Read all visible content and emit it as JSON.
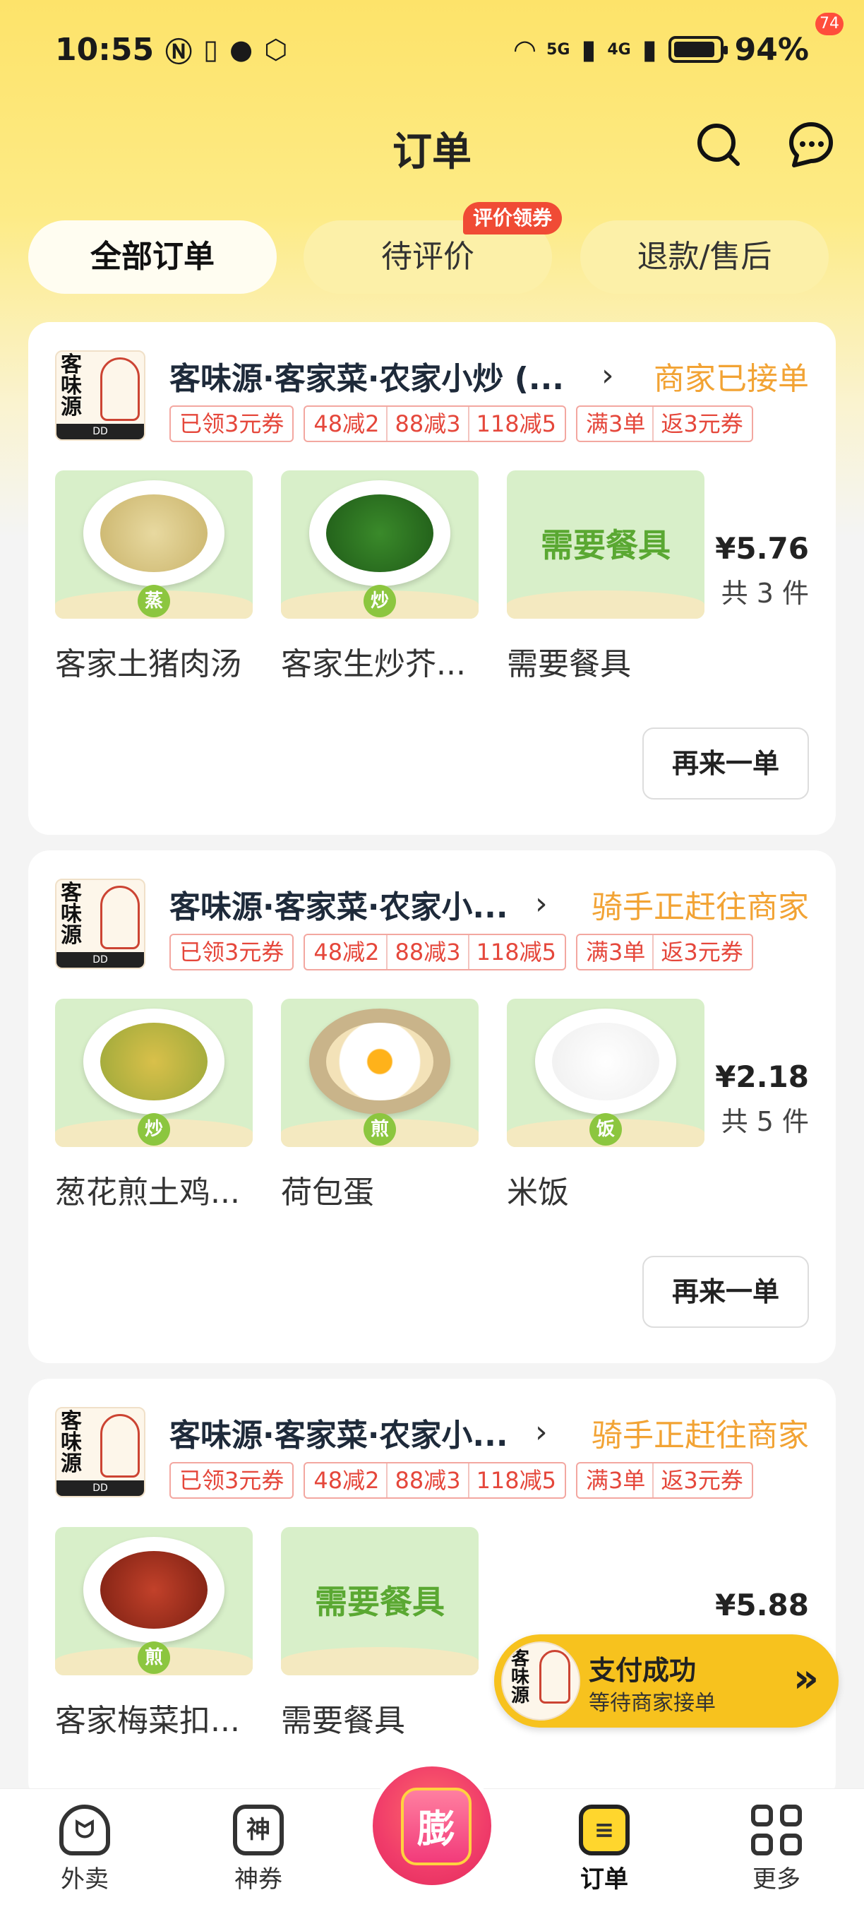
{
  "status_bar": {
    "time": "10:55",
    "battery": "94%",
    "net1": "5G",
    "net2": "4G"
  },
  "header": {
    "title": "订单",
    "message_count": "74"
  },
  "tabs": [
    {
      "label": "全部订单"
    },
    {
      "label": "待评价"
    },
    {
      "label": "退款/售后"
    }
  ],
  "tab_badge": "评价领券",
  "orders": [
    {
      "shop_name": "客味源·客家菜·农家小炒 (...",
      "status": "商家已接单",
      "promos": {
        "coupon": "已领3元券",
        "discounts": [
          "48减2",
          "88减3",
          "118减5"
        ],
        "bundle": [
          "满3单",
          "返3元券"
        ]
      },
      "items": [
        {
          "name": "客家土猪肉汤",
          "tag": "蒸"
        },
        {
          "name": "客家生炒芥...",
          "tag": "炒"
        },
        {
          "name": "需要餐具",
          "thumb_text": "需要餐具"
        }
      ],
      "price": "¥5.76",
      "count": "共 3 件",
      "reorder": "再来一单"
    },
    {
      "shop_name": "客味源·客家菜·农家小...",
      "status": "骑手正赶往商家",
      "promos": {
        "coupon": "已领3元券",
        "discounts": [
          "48减2",
          "88减3",
          "118减5"
        ],
        "bundle": [
          "满3单",
          "返3元券"
        ]
      },
      "items": [
        {
          "name": "葱花煎土鸡...",
          "tag": "炒"
        },
        {
          "name": "荷包蛋",
          "tag": "煎"
        },
        {
          "name": "米饭",
          "tag": "饭"
        }
      ],
      "price": "¥2.18",
      "count": "共 5 件",
      "reorder": "再来一单"
    },
    {
      "shop_name": "客味源·客家菜·农家小...",
      "status": "骑手正赶往商家",
      "promos": {
        "coupon": "已领3元券",
        "discounts": [
          "48减2",
          "88减3",
          "118减5"
        ],
        "bundle": [
          "满3单",
          "返3元券"
        ]
      },
      "items": [
        {
          "name": "客家梅菜扣...",
          "tag": "煎"
        },
        {
          "name": "需要餐具",
          "thumb_text": "需要餐具"
        }
      ],
      "price": "¥5.88"
    }
  ],
  "shop_logo": {
    "text": "客味源",
    "sub": "客家菜",
    "footer": "DD"
  },
  "pay_toast": {
    "title": "支付成功",
    "subtitle": "等待商家接单"
  },
  "bottom_nav": [
    {
      "label": "外卖"
    },
    {
      "label": "神券"
    },
    {
      "label": "订单"
    },
    {
      "label": "更多"
    }
  ],
  "nav_center_label": "膨",
  "colors": {
    "accent_yellow": "#ffd62d",
    "status_orange": "#f2a334",
    "promo_red": "#e5473b"
  }
}
